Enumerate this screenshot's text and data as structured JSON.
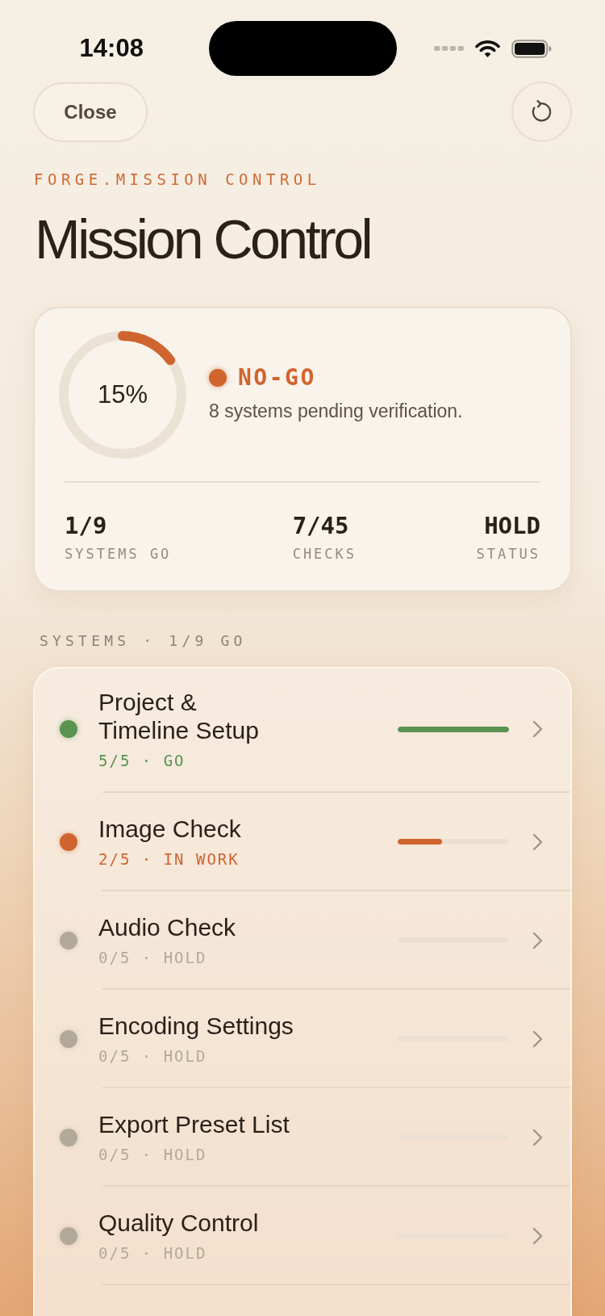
{
  "status_bar": {
    "time": "14:08"
  },
  "header": {
    "close_button": "Close",
    "eyebrow": "FORGE.MISSION CONTROL",
    "title": "Mission Control"
  },
  "summary": {
    "ring": {
      "level": 0.15,
      "percent": "15%"
    },
    "status": {
      "label": "NO-GO",
      "go": false,
      "message": "8 systems pending verification."
    },
    "stats": [
      {
        "value": "1/9",
        "label": "SYSTEMS GO"
      },
      {
        "value": "7/45",
        "label": "CHECKS"
      },
      {
        "value": "HOLD",
        "label": "STATUS"
      }
    ]
  },
  "systems": {
    "header": "SYSTEMS · 1/9 GO",
    "items": [
      {
        "title": "Project & Timeline Setup",
        "status": "5/5 · GO",
        "color": "#5a9250",
        "level": 1
      },
      {
        "title": "Image Check",
        "status": "2/5 · IN WORK",
        "color": "#d0642f",
        "level": 0.4
      },
      {
        "title": "Audio Check",
        "status": "0/5 · HOLD",
        "color": "#b2a999",
        "level": 0
      },
      {
        "title": "Encoding Settings",
        "status": "0/5 · HOLD",
        "color": "#b2a999",
        "level": 0
      },
      {
        "title": "Export Preset List",
        "status": "0/5 · HOLD",
        "color": "#b2a999",
        "level": 0
      },
      {
        "title": "Quality Control",
        "status": "0/5 · HOLD",
        "color": "#b2a999",
        "level": 0
      }
    ]
  }
}
